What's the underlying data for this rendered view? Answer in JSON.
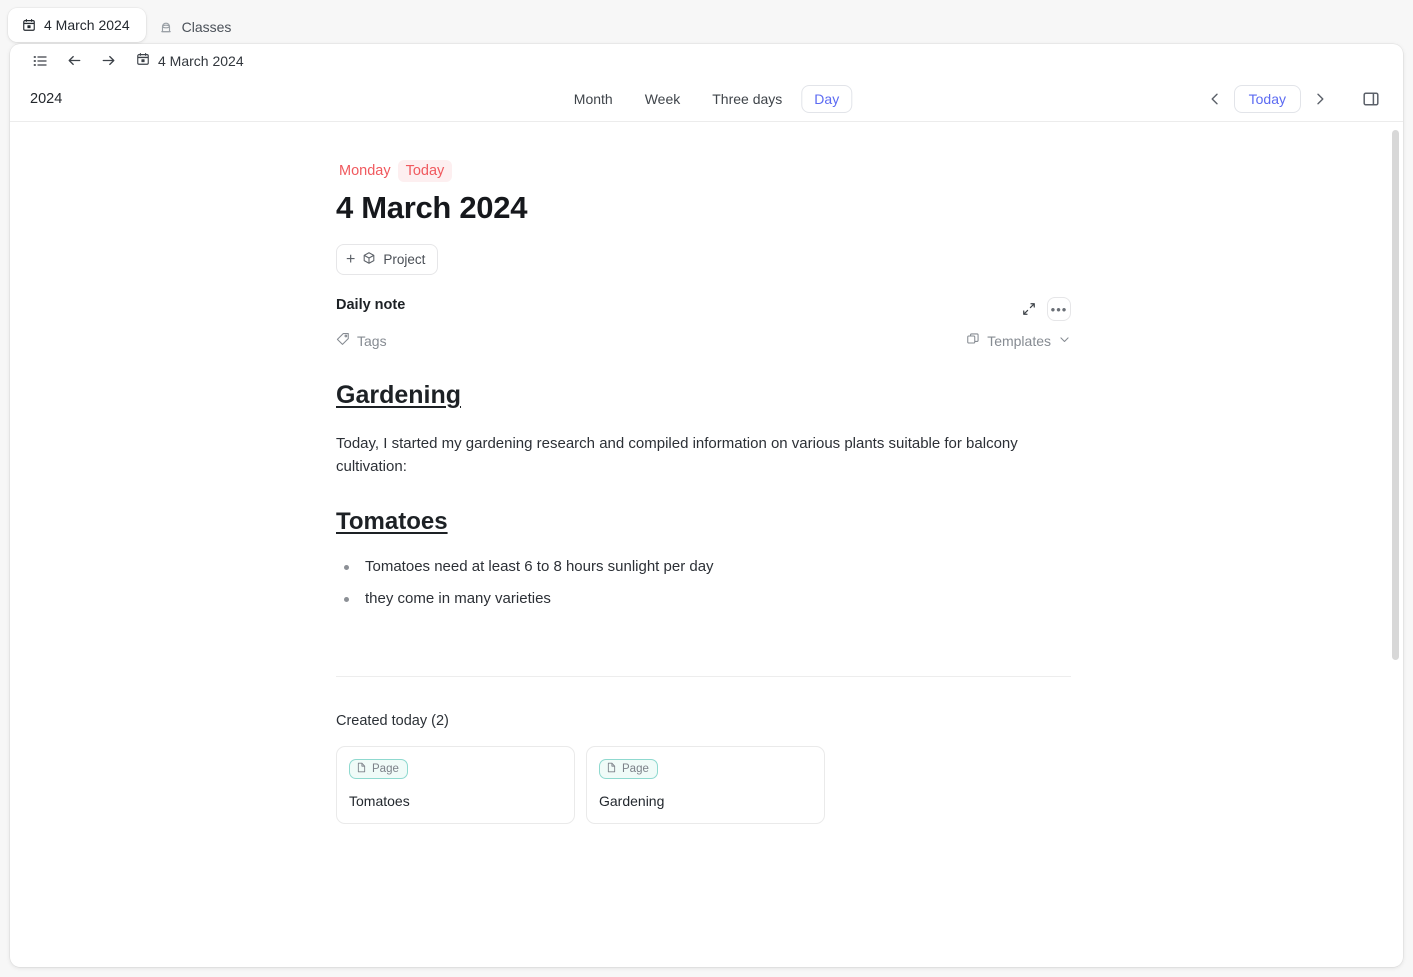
{
  "tabs": [
    {
      "label": "4 March 2024",
      "icon": "calendar-icon",
      "active": true
    },
    {
      "label": "Classes",
      "icon": "database-lock-icon",
      "active": false
    }
  ],
  "navbar": {
    "list_icon": "list-icon",
    "back_icon": "arrow-left-icon",
    "forward_icon": "arrow-right-icon",
    "breadcrumb_icon": "calendar-icon",
    "breadcrumb": "4 March 2024"
  },
  "toolbar": {
    "year": "2024",
    "views": [
      {
        "label": "Month",
        "selected": false
      },
      {
        "label": "Week",
        "selected": false
      },
      {
        "label": "Three days",
        "selected": false
      },
      {
        "label": "Day",
        "selected": true
      }
    ],
    "prev_icon": "chevron-left-icon",
    "today_label": "Today",
    "next_icon": "chevron-right-icon",
    "panel_icon": "right-sidebar-toggle-icon"
  },
  "day": {
    "weekday": "Monday",
    "today_badge": "Today",
    "title": "4 March 2024",
    "project_button": {
      "label": "Project",
      "plus": "+",
      "icon": "cube-icon"
    }
  },
  "note": {
    "title": "Daily note",
    "expand_icon": "expand-arrows-icon",
    "more_icon": "ellipsis-icon",
    "more_glyph": "•••",
    "tags": {
      "label": "Tags",
      "icon": "tag-icon"
    },
    "templates": {
      "label": "Templates",
      "icon": "templates-icon",
      "chevron": "chevron-down-icon"
    },
    "body": {
      "heading_1": "Gardening",
      "paragraph": "Today, I started my gardening research and compiled information on various plants suitable for balcony cultivation:",
      "heading_2": "Tomatoes",
      "bullets": [
        "Tomatoes need at least 6 to 8 hours sunlight per day",
        "they come in many varieties"
      ]
    }
  },
  "created_today": {
    "title": "Created today (2)",
    "cards": [
      {
        "badge": "Page",
        "badge_icon": "page-icon",
        "title": "Tomatoes"
      },
      {
        "badge": "Page",
        "badge_icon": "page-icon",
        "title": "Gardening"
      }
    ]
  },
  "colors": {
    "accent_blue": "#5c6bf2",
    "accent_red": "#f0595e",
    "badge_teal": "#8fd9cf",
    "window_bg": "#ffffff",
    "page_bg": "#f7f7f7"
  }
}
